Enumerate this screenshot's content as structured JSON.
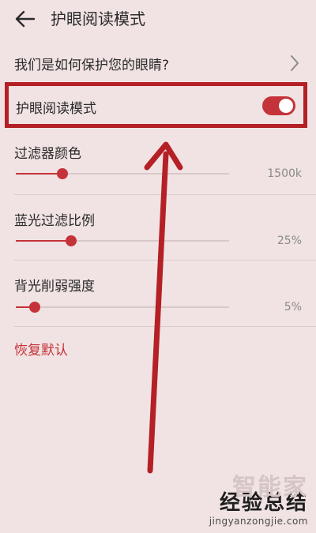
{
  "header": {
    "title": "护眼阅读模式",
    "back_icon": "arrow-left-icon"
  },
  "protect_link": {
    "label": "我们是如何保护您的眼睛?",
    "icon": "chevron-right-icon"
  },
  "reading_mode": {
    "label": "护眼阅读模式",
    "enabled": true
  },
  "sliders": [
    {
      "label": "过滤器颜色",
      "value_text": "1500k",
      "level": 0.22
    },
    {
      "label": "蓝光过滤比例",
      "value_text": "25%",
      "level": 0.26
    },
    {
      "label": "背光削弱强度",
      "value_text": "5%",
      "level": 0.09
    }
  ],
  "restore_default": "恢复默认",
  "watermark": {
    "bg_text": "智能家",
    "cn": "经验总结",
    "url": "jingyanzongjie.com"
  },
  "colors": {
    "accent": "#c5333a",
    "highlight_border": "#b42025",
    "background": "#f1e3e3"
  }
}
